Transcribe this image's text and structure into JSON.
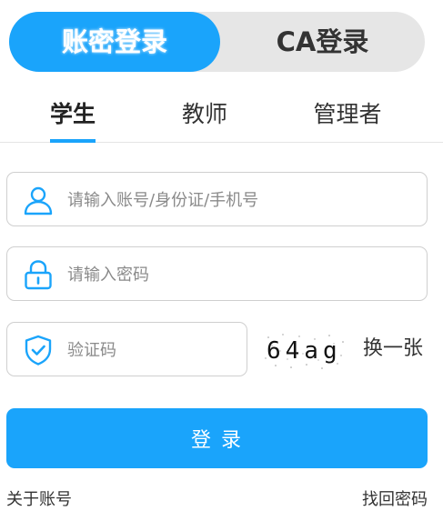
{
  "mode_switch": {
    "account_login_label": "账密登录",
    "ca_login_label": "CA登录"
  },
  "role_tabs": [
    {
      "label": "学生"
    },
    {
      "label": "教师"
    },
    {
      "label": "管理者"
    }
  ],
  "fields": {
    "account": {
      "placeholder": "请输入账号/身份证/手机号",
      "value": ""
    },
    "password": {
      "placeholder": "请输入密码",
      "value": ""
    },
    "captcha": {
      "placeholder": "验证码",
      "value": ""
    }
  },
  "captcha": {
    "code": "64ag",
    "refresh_label": "换一张"
  },
  "login_button": {
    "label": "登  录"
  },
  "footer": {
    "about_label": "关于账号",
    "recover_label": "找回密码"
  },
  "colors": {
    "accent": "#1aa4fb",
    "switch_background": "#e6e6e6",
    "border": "#cfcfcf",
    "text": "#333333"
  },
  "icons": {
    "account": "user-icon",
    "password": "lock-icon",
    "captcha": "shield-check-icon"
  }
}
